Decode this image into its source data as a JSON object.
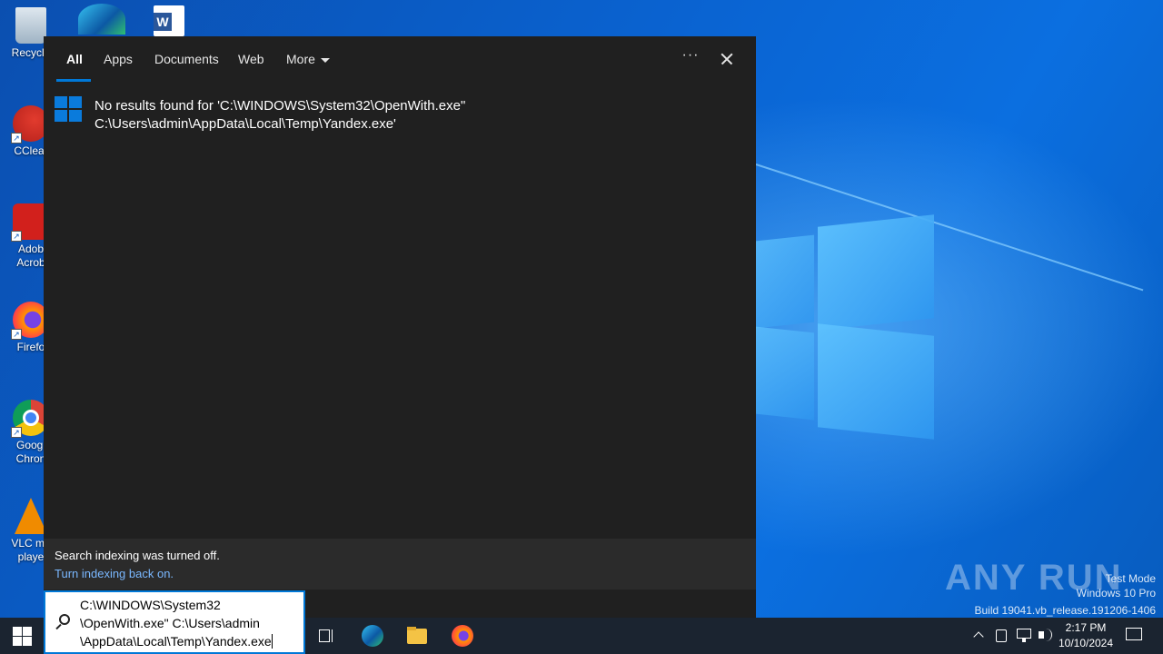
{
  "desktop": {
    "icons": [
      {
        "label": "Recycle",
        "icon": "recycle-bin-icon"
      },
      {
        "label": "",
        "icon": "edge-icon"
      },
      {
        "label": "",
        "icon": "word-doc-icon"
      },
      {
        "label": "CClear",
        "icon": "ccleaner-icon"
      },
      {
        "label": "Adob\nAcrob",
        "icon": "acrobat-icon"
      },
      {
        "label": "Firefo",
        "icon": "firefox-icon"
      },
      {
        "label": "Googl\nChron",
        "icon": "chrome-icon"
      },
      {
        "label": "VLC me\nplaye",
        "icon": "vlc-icon"
      }
    ]
  },
  "search_panel": {
    "tabs": [
      {
        "label": "All",
        "active": true
      },
      {
        "label": "Apps"
      },
      {
        "label": "Documents"
      },
      {
        "label": "Web"
      },
      {
        "label": "More"
      }
    ],
    "result": {
      "line1": "No results found for 'C:\\WINDOWS\\System32\\OpenWith.exe\"",
      "line2": "C:\\Users\\admin\\AppData\\Local\\Temp\\Yandex.exe'"
    },
    "indexing": {
      "message": "Search indexing was turned off.",
      "link": "Turn indexing back on."
    }
  },
  "taskbar": {
    "search_value": "C:\\WINDOWS\\System32\n\\OpenWith.exe\" C:\\Users\\admin\n\\AppData\\Local\\Temp\\Yandex.exe",
    "apps": [
      "task-view-icon",
      "edge-icon",
      "file-explorer-icon",
      "firefox-icon"
    ],
    "clock": {
      "time": "2:17 PM",
      "date": "10/10/2024"
    }
  },
  "watermark": {
    "brand": "ANY RUN",
    "mode": "Test Mode",
    "edition": "Windows 10 Pro",
    "build": "Build 19041.vb_release.191206-1406"
  },
  "colors": {
    "accent": "#0078d7",
    "panel": "#202020",
    "link": "#7ab8ff"
  }
}
